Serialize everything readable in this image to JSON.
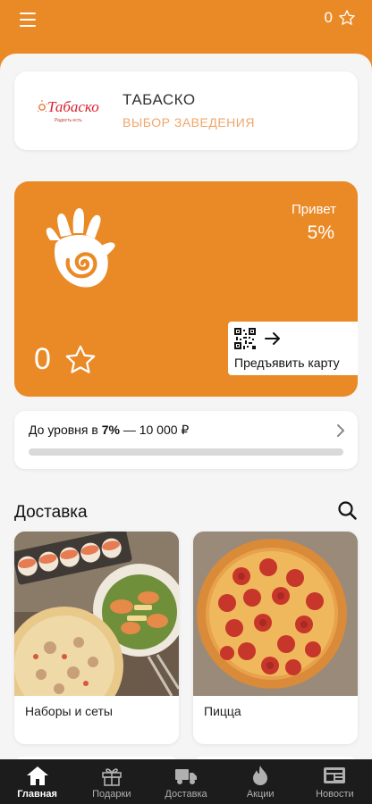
{
  "header": {
    "star_count": "0"
  },
  "venue": {
    "logo_text": "Табаско",
    "logo_tagline": "Радость есть",
    "name": "ТАБАСКО",
    "select_label": "ВЫБОР ЗАВЕДЕНИЯ"
  },
  "loyalty": {
    "greeting": "Привет",
    "discount": "5%",
    "points": "0",
    "present_label": "Предъявить карту"
  },
  "level": {
    "prefix": "До уровня в ",
    "next_percent": "7%",
    "suffix": " — 10 000 ₽",
    "progress": 0.0
  },
  "section": {
    "title": "Доставка"
  },
  "products": [
    {
      "name": "Наборы и сеты"
    },
    {
      "name": "Пицца"
    }
  ],
  "tabs": [
    {
      "label": "Главная",
      "icon": "home-icon",
      "active": true
    },
    {
      "label": "Подарки",
      "icon": "gift-icon",
      "active": false
    },
    {
      "label": "Доставка",
      "icon": "truck-icon",
      "active": false
    },
    {
      "label": "Акции",
      "icon": "flame-icon",
      "active": false
    },
    {
      "label": "Новости",
      "icon": "news-icon",
      "active": false
    }
  ],
  "colors": {
    "brand": "#ea8a27",
    "accent_light": "#f0a66a",
    "tabbar": "#1c1c1c"
  }
}
